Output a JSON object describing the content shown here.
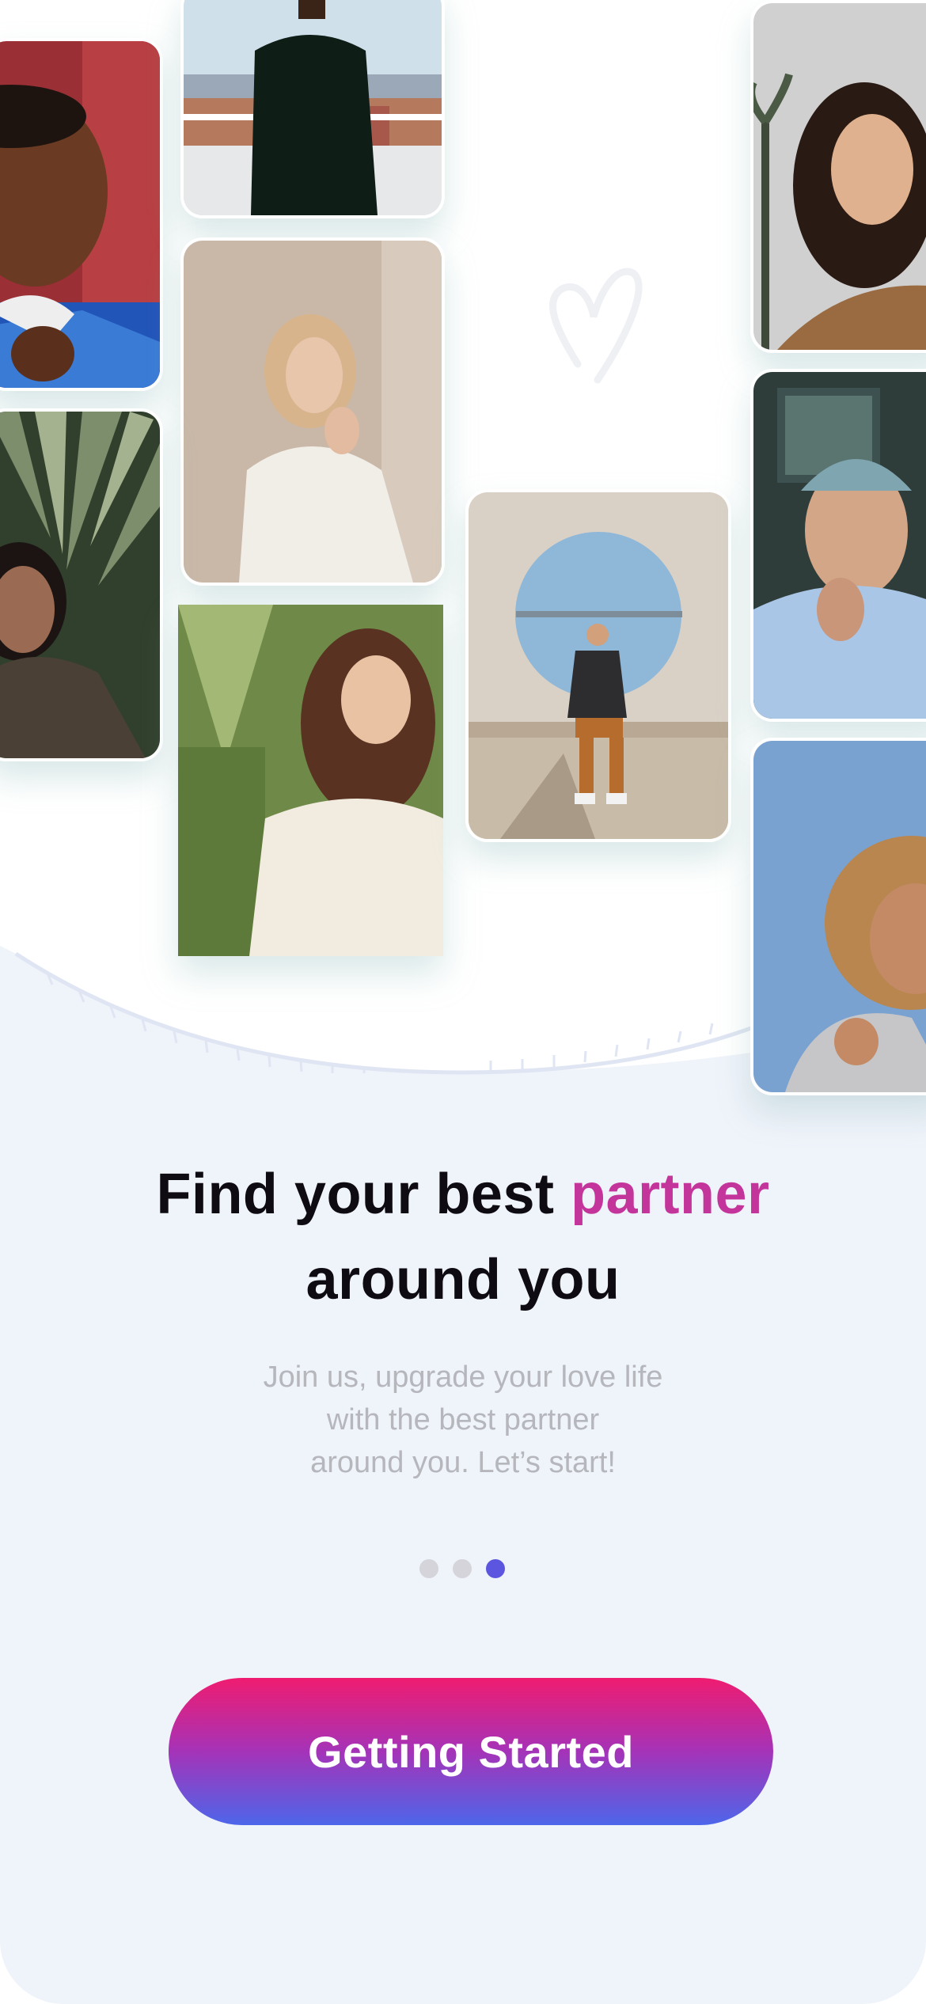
{
  "onboarding": {
    "headline_part1": "Find your best ",
    "headline_accent": "partner",
    "headline_part2": "around you",
    "subtitle_lines": [
      "Join us, upgrade your love life",
      "with the best partner",
      "around you. Let’s start!"
    ],
    "page_indicator": {
      "total": 3,
      "current": 3
    },
    "cta_label": "Getting Started"
  },
  "colors": {
    "accent": "#c4359b",
    "active_dot": "#5b55e0",
    "inactive_dot": "#d4d4da",
    "cta_gradient": [
      "#ef1c70",
      "#a533b8",
      "#4d66ea"
    ],
    "background": "#eff3fa"
  },
  "photos": [
    {
      "name": "photo-woman-red-wall"
    },
    {
      "name": "photo-man-black-turtleneck"
    },
    {
      "name": "photo-woman-blonde-white-shirt"
    },
    {
      "name": "photo-woman-palm-leaves"
    },
    {
      "name": "photo-woman-white-tee"
    },
    {
      "name": "photo-man-sitting-circle-wall"
    },
    {
      "name": "photo-woman-smiling-palms"
    },
    {
      "name": "photo-man-beanie"
    },
    {
      "name": "photo-woman-curly-hair"
    }
  ]
}
